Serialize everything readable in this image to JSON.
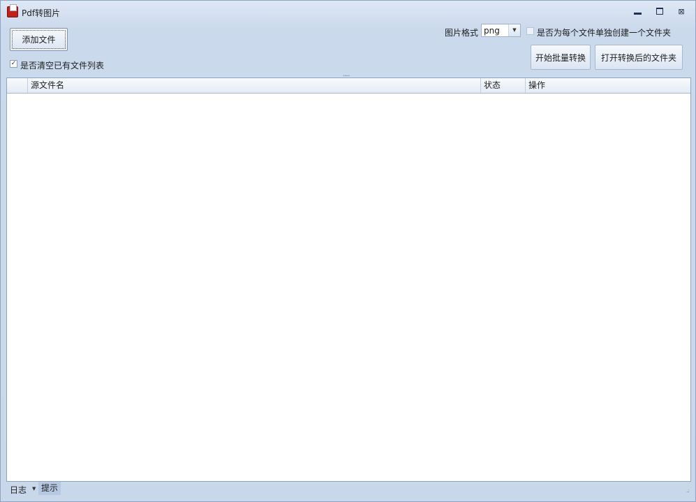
{
  "window": {
    "title": "Pdf转图片",
    "minimize_glyph": "▭",
    "maximize_glyph": "□",
    "close_glyph": "⊠"
  },
  "toolbar": {
    "add_file_label": "添加文件",
    "clear_list_label": "是否清空已有文件列表",
    "clear_list_checked": "✓",
    "format_label": "图片格式",
    "format_value": "png",
    "format_arrow": "▼",
    "separate_folder_label": "是否为每个文件单独创建一个文件夹",
    "start_label": "开始批量转换",
    "open_folder_label": "打开转换后的文件夹",
    "splitter_grip": "....."
  },
  "grid": {
    "columns": [
      "",
      "源文件名",
      "状态",
      "操作"
    ],
    "rows": []
  },
  "statusbar": {
    "log_label": "日志",
    "log_caret": "▼",
    "tip_label": "提示",
    "size_grip": "..:"
  },
  "colors": {
    "accent": "#c9d7ea",
    "border": "#8ea4c1"
  }
}
